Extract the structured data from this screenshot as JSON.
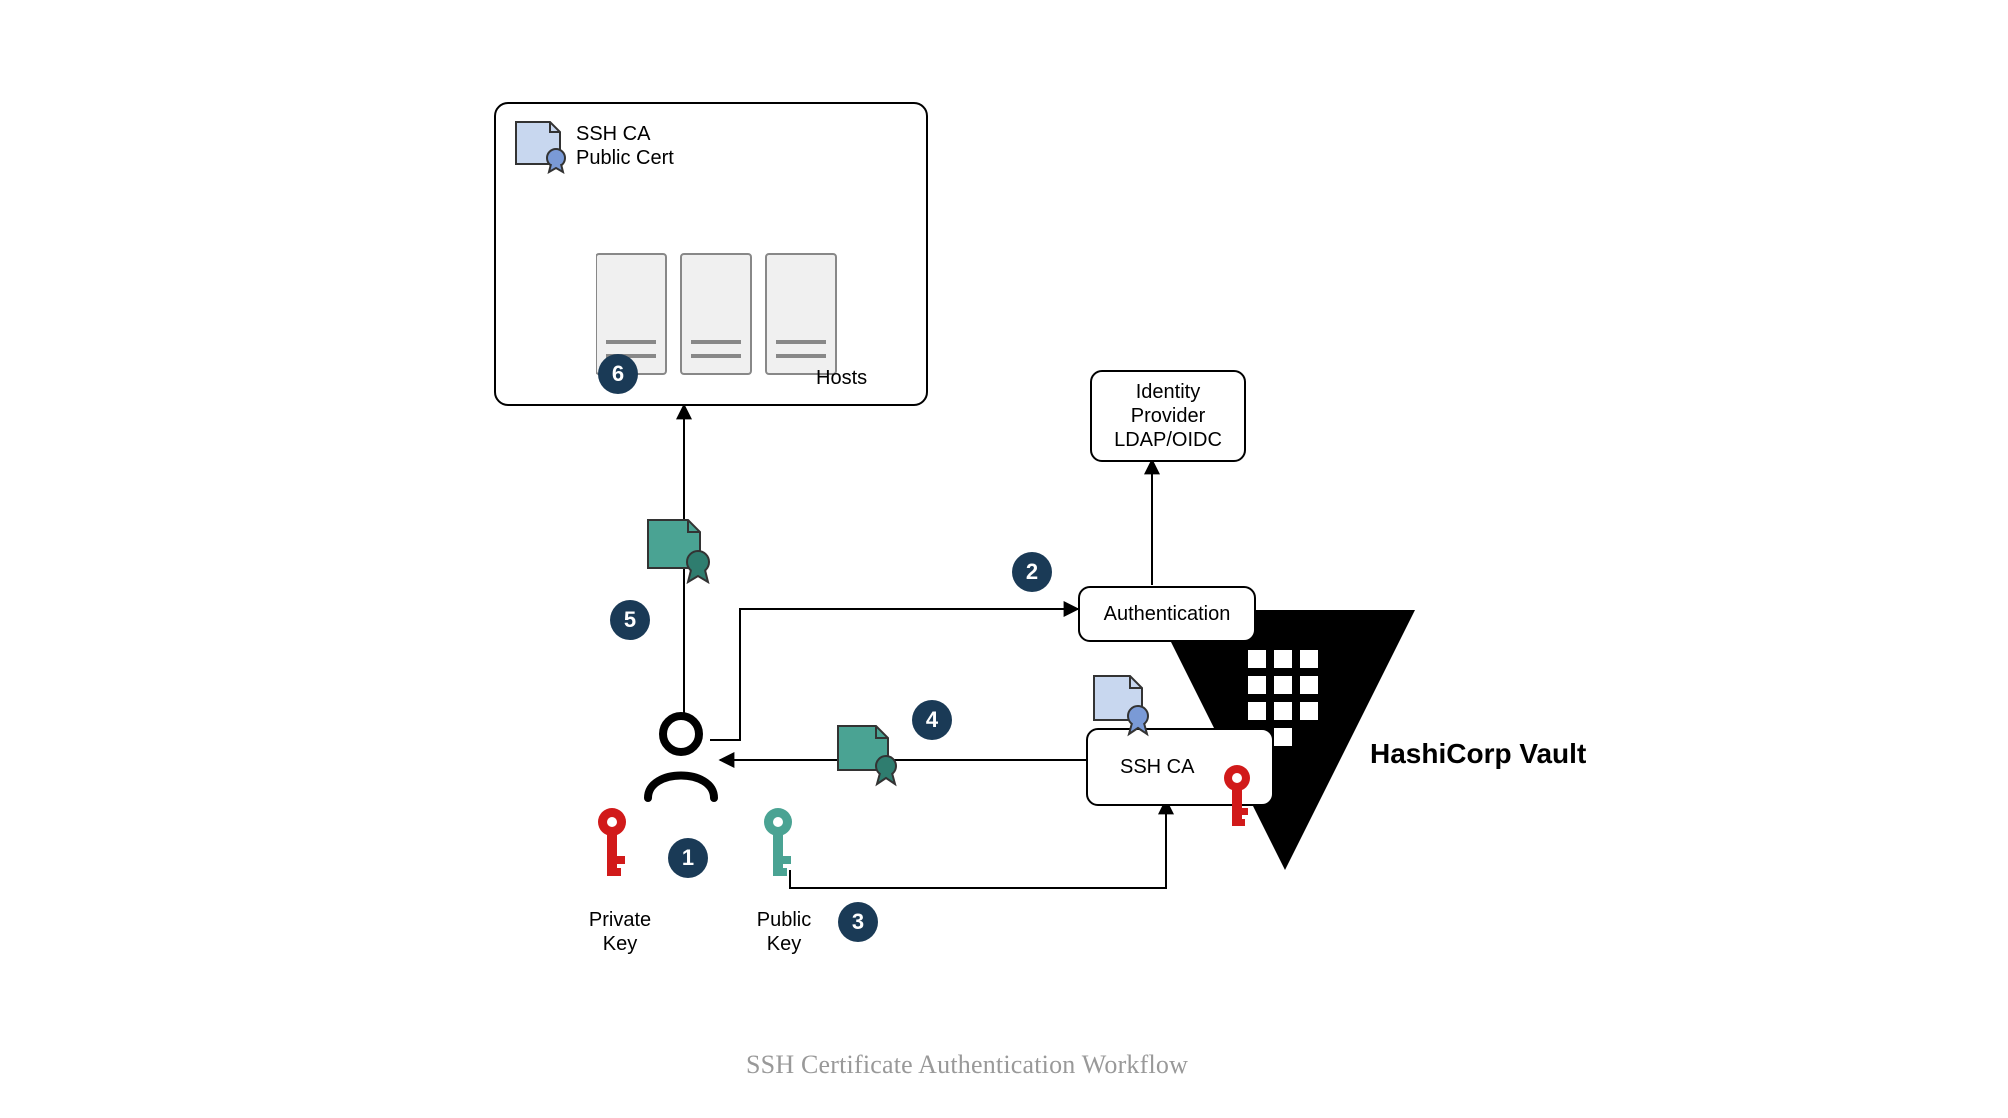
{
  "caption": "SSH Certificate Authentication Workflow",
  "hosts": {
    "cert_label_l1": "SSH CA",
    "cert_label_l2": "Public Cert",
    "label": "Hosts"
  },
  "idp": {
    "l1": "Identity",
    "l2": "Provider",
    "l3": "LDAP/OIDC"
  },
  "auth_label": "Authentication",
  "ssh_ca_label": "SSH CA",
  "vault_label": "HashiCorp Vault",
  "user": {
    "private_key_l1": "Private",
    "private_key_l2": "Key",
    "public_key_l1": "Public",
    "public_key_l2": "Key"
  },
  "steps": {
    "s1": "1",
    "s2": "2",
    "s3": "3",
    "s4": "4",
    "s5": "5",
    "s6": "6"
  },
  "colors": {
    "badge": "#1a3a56",
    "teal": "#4aa393",
    "red": "#d11a1a",
    "lightblue": "#c8d7ef"
  }
}
